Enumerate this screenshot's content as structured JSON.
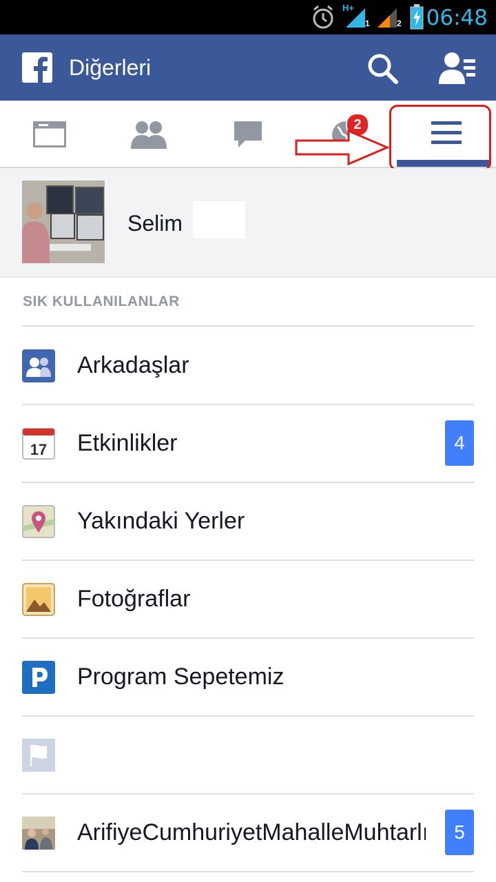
{
  "status_bar": {
    "time": "06:48",
    "icons": [
      "alarm-icon",
      "signal-icon",
      "signal-icon",
      "battery-charging-icon"
    ],
    "network_label_1": "H+",
    "sim_1": "1",
    "sim_2": "2"
  },
  "header": {
    "title": "Diğerleri",
    "icons": [
      "facebook-logo-icon",
      "search-icon",
      "friend-requests-icon"
    ],
    "bg_color": "#3b5998"
  },
  "tabs": [
    {
      "name": "news-feed",
      "icon": "news-feed-icon"
    },
    {
      "name": "friends",
      "icon": "friends-icon"
    },
    {
      "name": "messages",
      "icon": "chat-bubble-icon"
    },
    {
      "name": "notifications",
      "icon": "globe-icon",
      "badge": "2"
    },
    {
      "name": "more",
      "icon": "hamburger-menu-icon",
      "active": true
    }
  ],
  "profile": {
    "name": "Selim"
  },
  "section_title": "SIK KULLANILANLAR",
  "calendar_day": "17",
  "items": [
    {
      "label": "Arkadaşlar",
      "icon": "friends-icon",
      "count": ""
    },
    {
      "label": "Etkinlikler",
      "icon": "calendar-icon",
      "count": "4"
    },
    {
      "label": "Yakındaki Yerler",
      "icon": "map-pin-icon",
      "count": ""
    },
    {
      "label": "Fotoğraflar",
      "icon": "photos-icon",
      "count": ""
    },
    {
      "label": "Program Sepetemiz",
      "icon": "page-p-icon",
      "count": ""
    },
    {
      "label": "",
      "icon": "flag-icon",
      "count": ""
    },
    {
      "label": "ArifiyeCumhuriyetMahalleMuhtarlığı",
      "icon": "group-photo-icon",
      "count": "5"
    }
  ],
  "colors": {
    "accent": "#3b5998",
    "badge_blue": "#4080ff",
    "badge_red": "#e02424",
    "annotation_red": "#e01b1b",
    "status_text": "#33b5e5"
  }
}
